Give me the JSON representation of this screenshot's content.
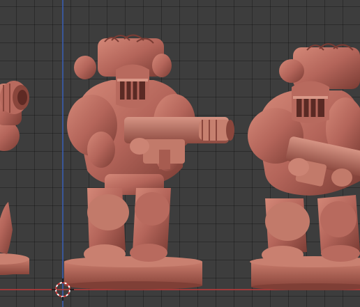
{
  "viewport": {
    "mode": "3D viewport",
    "background_color": "#3d3d3d",
    "grid_color": "#2e2e2e",
    "axis_x_color": "#c23a3a",
    "axis_y_color": "#3a5fb8",
    "model_color": "#b4655a",
    "cursor_icon": "3d-cursor-icon"
  },
  "objects": [
    {
      "name": "miniature-left-partial"
    },
    {
      "name": "miniature-center"
    },
    {
      "name": "miniature-right"
    }
  ]
}
